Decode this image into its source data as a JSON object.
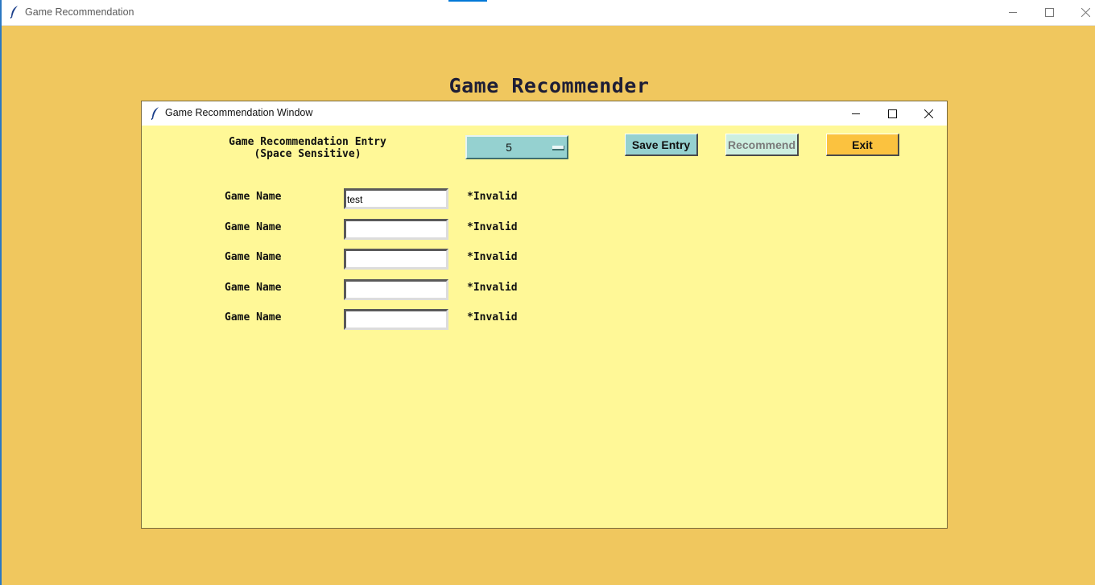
{
  "main_window": {
    "title": "Game Recommendation",
    "heading": "Game Recommender"
  },
  "child_window": {
    "title": "Game Recommendation Window",
    "entry_label_line1": "Game Recommendation Entry",
    "entry_label_line2": "(Space Sensitive)",
    "count_selected": "5",
    "buttons": {
      "save": "Save Entry",
      "recommend": "Recommend",
      "exit": "Exit"
    },
    "rows": [
      {
        "label": "Game Name",
        "value": "test",
        "status": "*Invalid"
      },
      {
        "label": "Game Name",
        "value": "",
        "status": "*Invalid"
      },
      {
        "label": "Game Name",
        "value": "",
        "status": "*Invalid"
      },
      {
        "label": "Game Name",
        "value": "",
        "status": "*Invalid"
      },
      {
        "label": "Game Name",
        "value": "",
        "status": "*Invalid"
      }
    ]
  },
  "colors": {
    "background": "#f0c75e",
    "panel": "#fff897",
    "teal": "#95d1d0",
    "recommend_disabled": "#cdefe0",
    "exit": "#fbc23f"
  },
  "icons": [
    "feather-icon",
    "minimize-icon",
    "maximize-icon",
    "close-icon",
    "dropdown-indicator-icon"
  ]
}
